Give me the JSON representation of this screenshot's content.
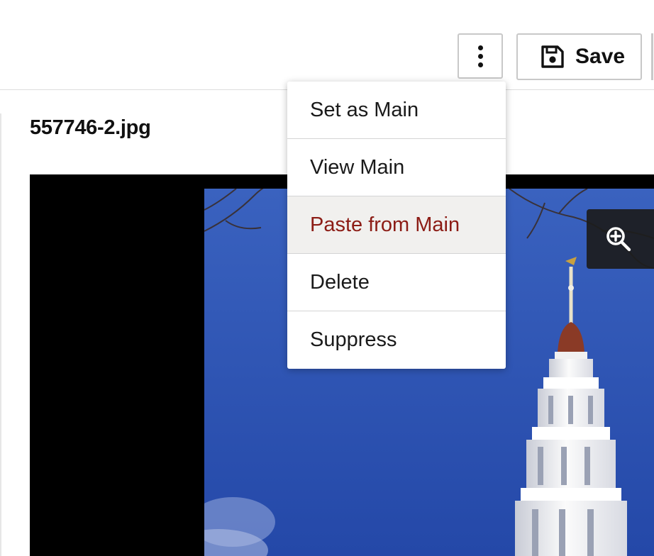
{
  "toolbar": {
    "more_icon": "vertical-ellipsis-icon",
    "save_icon": "floppy-disk-icon",
    "save_label": "Save"
  },
  "file": {
    "name": "557746-2.jpg"
  },
  "viewer": {
    "zoom_icon": "zoom-in-icon"
  },
  "menu": {
    "items": [
      {
        "label": "Set as Main"
      },
      {
        "label": "View Main"
      },
      {
        "label": "Paste from Main"
      },
      {
        "label": "Delete"
      },
      {
        "label": "Suppress"
      }
    ],
    "highlighted_item": "Paste from Main"
  },
  "colors": {
    "highlight_text": "#8c1c15",
    "highlight_background": "#f1f0ee",
    "sky": "#2f57b8",
    "viewer_background": "#000000"
  }
}
